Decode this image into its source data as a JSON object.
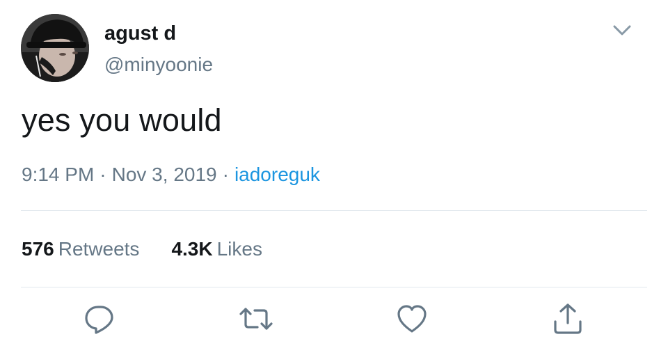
{
  "user": {
    "display_name": "agust d",
    "handle": "@minyoonie",
    "avatar_icon": "profile-photo"
  },
  "tweet": {
    "text": "yes you would",
    "time": "9:14 PM",
    "date": "Nov 3, 2019",
    "separator": "·",
    "source": "iadoreguk"
  },
  "stats": {
    "retweets_count": "576",
    "retweets_label": "Retweets",
    "likes_count": "4.3K",
    "likes_label": "Likes"
  },
  "actions": {
    "reply_icon": "reply-icon",
    "retweet_icon": "retweet-icon",
    "like_icon": "heart-icon",
    "share_icon": "share-icon",
    "menu_icon": "chevron-down-icon"
  },
  "colors": {
    "text_primary": "#14171a",
    "text_secondary": "#657786",
    "link": "#1b95e0",
    "divider": "#e1e8ed"
  }
}
